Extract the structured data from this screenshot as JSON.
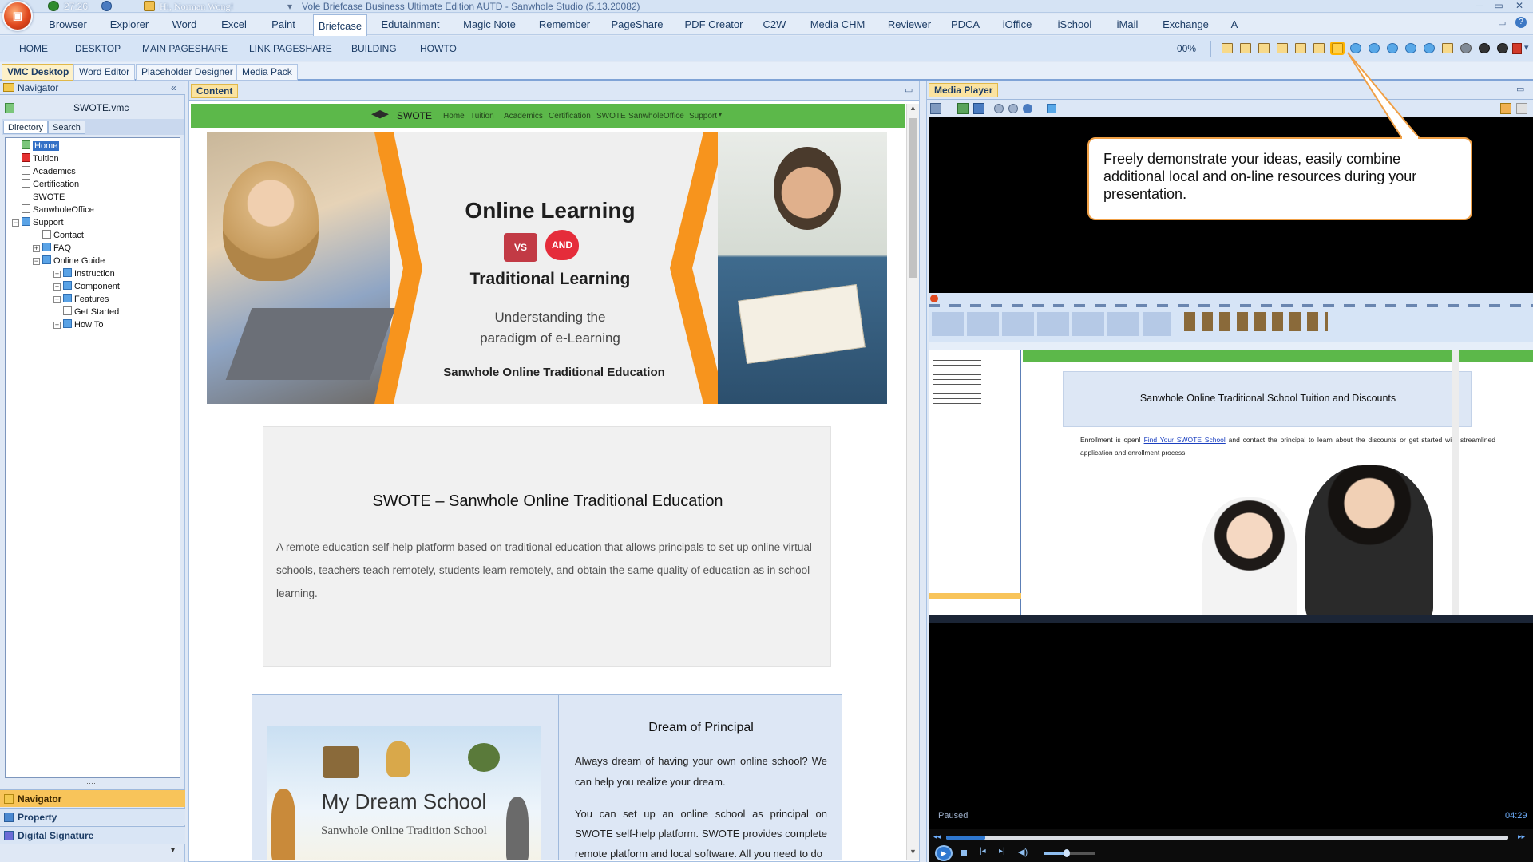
{
  "window": {
    "time": "27:26",
    "greeting": "Hi, Norman Wong!",
    "title": "Vole Briefcase Business Ultimate Edition AUTD - Sanwhole Studio (5.13.20082)"
  },
  "menu": [
    "Browser",
    "Explorer",
    "Word",
    "Excel",
    "Paint",
    "Briefcase",
    "Edutainment",
    "Magic Note",
    "Remember",
    "PageShare",
    "PDF Creator",
    "C2W",
    "Media CHM",
    "Reviewer",
    "PDCA",
    "iOffice",
    "iSchool",
    "iMail",
    "Exchange",
    "A"
  ],
  "ribbon": {
    "items": [
      "HOME",
      "DESKTOP",
      "MAIN PAGESHARE",
      "LINK PAGESHARE",
      "BUILDING",
      "HOWTO"
    ],
    "zoom": "00%"
  },
  "tabs": [
    "VMC Desktop",
    "Word Editor",
    "Placeholder Designer",
    "Media Pack"
  ],
  "navigator": {
    "title": "Navigator",
    "file": "SWOTE.vmc",
    "subtabs": [
      "Directory",
      "Search"
    ],
    "tree": [
      {
        "label": "Home",
        "level": 0,
        "icon": "home",
        "selected": true,
        "mark": true
      },
      {
        "label": "Tuition",
        "level": 0,
        "icon": "pdf",
        "mark": true
      },
      {
        "label": "Academics",
        "level": 0,
        "icon": "page"
      },
      {
        "label": "Certification",
        "level": 0,
        "icon": "page"
      },
      {
        "label": "SWOTE",
        "level": 0,
        "icon": "music",
        "mark": true
      },
      {
        "label": "SanwholeOffice",
        "level": 0,
        "icon": "page"
      },
      {
        "label": "Support",
        "level": 0,
        "icon": "folder",
        "expander": "−"
      },
      {
        "label": "Contact",
        "level": 1,
        "icon": "page"
      },
      {
        "label": "FAQ",
        "level": 1,
        "icon": "folder",
        "expander": "+"
      },
      {
        "label": "Online Guide",
        "level": 1,
        "icon": "folder",
        "expander": "−"
      },
      {
        "label": "Instruction",
        "level": 2,
        "icon": "folder",
        "expander": "+"
      },
      {
        "label": "Component",
        "level": 2,
        "icon": "folder",
        "expander": "+"
      },
      {
        "label": "Features",
        "level": 2,
        "icon": "folder",
        "expander": "+"
      },
      {
        "label": "Get Started",
        "level": 2,
        "icon": "page"
      },
      {
        "label": "How To",
        "level": 2,
        "icon": "folder",
        "expander": "+"
      }
    ],
    "accordion": [
      "Navigator",
      "Property",
      "Digital Signature"
    ]
  },
  "content": {
    "title": "Content",
    "site_nav": {
      "brand": "SWOTE",
      "links": [
        "Home",
        "Tuition",
        "Academics",
        "Certification",
        "SWOTE",
        "SanwholeOffice",
        "Support"
      ]
    },
    "hero": {
      "title": "Online Learning",
      "vs": "VS",
      "and": "AND",
      "title2": "Traditional Learning",
      "sub1": "Understanding the",
      "sub2": "paradigm of e-Learning",
      "tagline": "Sanwhole Online Traditional Education"
    },
    "intro": {
      "heading": "SWOTE – Sanwhole Online Traditional Education",
      "body": "A remote education self-help platform based on traditional education that allows principals to set up online virtual schools, teachers teach remotely, students learn remotely, and obtain the same quality of education as in school learning."
    },
    "card": {
      "img_title": "My Dream School",
      "img_sub": "Sanwhole Online Tradition School",
      "heading": "Dream of Principal",
      "p1": "Always dream of having your own online school? We can help you realize your dream.",
      "p2": "You can set up an online school as principal on SWOTE self-help platform. SWOTE provides complete remote platform and local software. All you need to do"
    }
  },
  "media": {
    "title": "Media Player",
    "status": "Paused",
    "time": "04:29",
    "progress": 0.07,
    "volume": 0.45,
    "callout": "Freely demonstrate your ideas, easily combine additional local and on-line resources during your presentation.",
    "screen": {
      "heading": "Sanwhole Online Traditional School Tuition and Discounts",
      "text": "Enrollment is open!",
      "link": "Find Your SWOTE School",
      "text2": "and contact the principal to learn about the discounts or get started with streamlined application and enrollment process!"
    }
  },
  "colors": {
    "accent": "#f7941d",
    "green": "#5cb84a",
    "selection": "#3370c6"
  }
}
